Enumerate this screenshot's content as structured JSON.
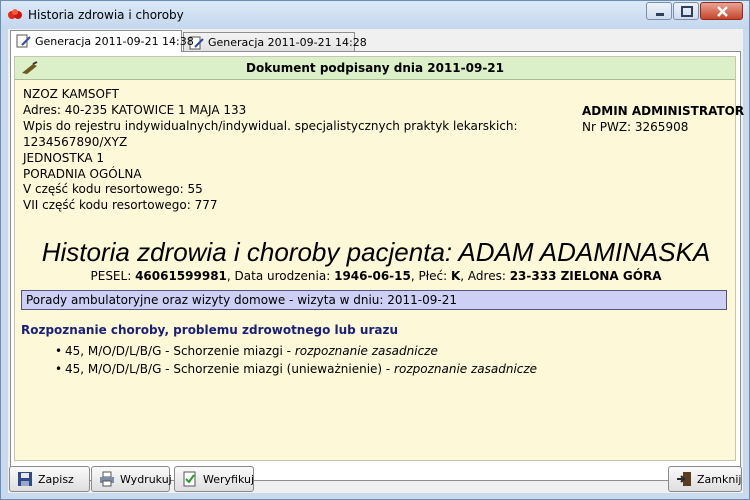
{
  "window": {
    "title": "Historia zdrowia i choroby",
    "icon": "app-logo-icon",
    "controls": [
      "minimize-icon",
      "maximize-icon",
      "close-icon"
    ]
  },
  "tabs": [
    {
      "label": "Generacja 2011-09-21 14:38",
      "active": true
    },
    {
      "label": "Generacja 2011-09-21 14:28",
      "active": false
    }
  ],
  "document": {
    "signed_text": "Dokument podpisany dnia 2011-09-21",
    "clinic": {
      "name": "NZOZ KAMSOFT",
      "address": "Adres: 40-235 KATOWICE 1 MAJA 133",
      "registry": "Wpis do rejestru indywidualnych/indywidual. specjalistycznych praktyk lekarskich:",
      "registry_no": "1234567890/XYZ",
      "unit": "JEDNOSTKA 1",
      "clinic_type": "PORADNIA OGÓLNA",
      "code_v": "V część kodu resortowego: 55",
      "code_vii": "VII część kodu resortowego: 777"
    },
    "doctor": {
      "name": "ADMIN ADMINISTRATOR",
      "pwz": "Nr PWZ: 3265908"
    },
    "headline": "Historia zdrowia i choroby pacjenta: ADAM ADAMINASKA",
    "patient": {
      "pesel_label": "PESEL: ",
      "pesel": "46061599981",
      "dob_label": ", Data urodzenia: ",
      "dob": "1946-06-15",
      "sex_label": ", Płeć: ",
      "sex": "K",
      "address_label": ", Adres: ",
      "address": "23-333 ZIELONA GÓRA"
    },
    "visit": "Porady ambulatoryjne oraz wizyty domowe - wizyta w dniu: 2011-09-21",
    "diagnosis_section": "Rozpoznanie choroby, problemu zdrowotnego lub urazu",
    "diagnoses": [
      {
        "text": "45, M/O/D/L/B/G - Schorzenie miazgi - ",
        "type": "rozpoznanie zasadnicze"
      },
      {
        "text": "45, M/O/D/L/B/G - Schorzenie miazgi (unieważnienie) - ",
        "type": "rozpoznanie zasadnicze"
      }
    ]
  },
  "buttons": {
    "save": "Zapisz",
    "print": "Wydrukuj",
    "verify": "Weryfikuj",
    "close": "Zamknij"
  },
  "colors": {
    "title_bar": "#c4d7ee",
    "signed_bar": "#dbefc8",
    "document_bg": "#fcf8d8",
    "visit_box": "#cdcff5",
    "section_title": "#1a1f7a",
    "close_button": "#c7452b"
  }
}
